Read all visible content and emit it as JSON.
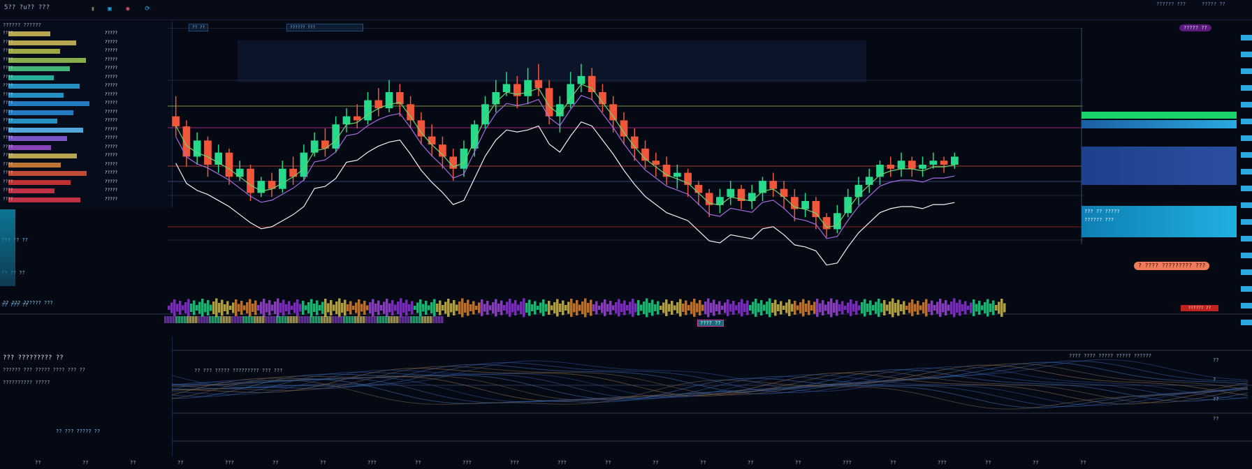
{
  "topbar": {
    "title": "5?? ?u?? ???",
    "icons": [
      {
        "name": "settings-icon",
        "glyph": "▮",
        "color": "#8a7a55"
      },
      {
        "name": "layout-icon",
        "glyph": "▣",
        "color": "#2aa9e0"
      },
      {
        "name": "alert-icon",
        "glyph": "◉",
        "color": "#e0556b"
      },
      {
        "name": "refresh-icon",
        "glyph": "⟳",
        "color": "#2aa9e0"
      }
    ],
    "right_labels": [
      "?????? ???",
      "????? ??"
    ]
  },
  "sidebar": {
    "header": "?????? ??????",
    "rows": [
      {
        "label": "????",
        "price": "?????",
        "color": "#d6c35a"
      },
      {
        "label": "????",
        "price": "?????",
        "color": "#d6c35a"
      },
      {
        "label": "????",
        "price": "?????",
        "color": "#b9c64d"
      },
      {
        "label": "????",
        "price": "?????",
        "color": "#9fcc55"
      },
      {
        "label": "????",
        "price": "?????",
        "color": "#4fd38a"
      },
      {
        "label": "????",
        "price": "?????",
        "color": "#2ecbb3"
      },
      {
        "label": "????",
        "price": "?????",
        "color": "#2aa9e0"
      },
      {
        "label": "????",
        "price": "?????",
        "color": "#2aa9e0"
      },
      {
        "label": "????",
        "price": "?????",
        "color": "#2a8fe0"
      },
      {
        "label": "????",
        "price": "?????",
        "color": "#2a8fe0"
      },
      {
        "label": "????",
        "price": "?????",
        "color": "#2aa9e0"
      },
      {
        "label": "????",
        "price": "?????",
        "color": "#5ec4ff"
      },
      {
        "label": "????",
        "price": "?????",
        "color": "#8f63e6"
      },
      {
        "label": "????",
        "price": "?????",
        "color": "#a04fd6"
      },
      {
        "label": "????",
        "price": "?????",
        "color": "#d6c35a"
      },
      {
        "label": "????",
        "price": "?????",
        "color": "#e08a3a"
      },
      {
        "label": "????",
        "price": "?????",
        "color": "#e0573a"
      },
      {
        "label": "????",
        "price": "?????",
        "color": "#e03a3a"
      },
      {
        "label": "????",
        "price": "?????",
        "color": "#e03a4f"
      },
      {
        "label": "????",
        "price": "?????",
        "color": "#e03a4f"
      }
    ],
    "side_labels": [
      "??? ?? ??",
      "?? ?? ??",
      "?? ??? ??"
    ]
  },
  "tabs": [
    "?? ??",
    "?????? ???"
  ],
  "chart_data": {
    "type": "candlestick",
    "colors": {
      "up": "#27d98a",
      "down": "#f0563a",
      "ma_fast": "#6fd36f",
      "ma_slow": "#a56be0",
      "price_line": "#f2f2f2"
    },
    "candles": [
      [
        60,
        55,
        70,
        50
      ],
      [
        55,
        40,
        58,
        35
      ],
      [
        40,
        48,
        52,
        36
      ],
      [
        48,
        36,
        50,
        30
      ],
      [
        36,
        42,
        46,
        32
      ],
      [
        42,
        30,
        44,
        26
      ],
      [
        30,
        34,
        38,
        28
      ],
      [
        34,
        22,
        36,
        18
      ],
      [
        22,
        28,
        30,
        20
      ],
      [
        28,
        24,
        32,
        20
      ],
      [
        24,
        34,
        38,
        22
      ],
      [
        34,
        30,
        40,
        26
      ],
      [
        30,
        42,
        46,
        28
      ],
      [
        42,
        48,
        52,
        40
      ],
      [
        48,
        44,
        54,
        40
      ],
      [
        44,
        56,
        60,
        42
      ],
      [
        56,
        60,
        64,
        52
      ],
      [
        60,
        58,
        66,
        54
      ],
      [
        58,
        68,
        72,
        56
      ],
      [
        68,
        64,
        74,
        60
      ],
      [
        64,
        72,
        78,
        62
      ],
      [
        72,
        66,
        76,
        60
      ],
      [
        66,
        58,
        70,
        54
      ],
      [
        58,
        50,
        62,
        46
      ],
      [
        50,
        46,
        56,
        40
      ],
      [
        46,
        40,
        50,
        34
      ],
      [
        40,
        34,
        44,
        28
      ],
      [
        34,
        44,
        48,
        30
      ],
      [
        44,
        56,
        58,
        40
      ],
      [
        56,
        66,
        70,
        54
      ],
      [
        66,
        72,
        78,
        62
      ],
      [
        72,
        76,
        82,
        70
      ],
      [
        76,
        70,
        80,
        64
      ],
      [
        70,
        78,
        84,
        66
      ],
      [
        78,
        74,
        86,
        70
      ],
      [
        74,
        60,
        78,
        56
      ],
      [
        60,
        66,
        70,
        52
      ],
      [
        66,
        76,
        82,
        64
      ],
      [
        76,
        80,
        86,
        72
      ],
      [
        80,
        72,
        84,
        68
      ],
      [
        72,
        66,
        76,
        62
      ],
      [
        66,
        58,
        70,
        52
      ],
      [
        58,
        50,
        62,
        46
      ],
      [
        50,
        44,
        54,
        38
      ],
      [
        44,
        38,
        48,
        34
      ],
      [
        38,
        36,
        42,
        30
      ],
      [
        36,
        30,
        40,
        26
      ],
      [
        30,
        32,
        36,
        24
      ],
      [
        32,
        26,
        34,
        20
      ],
      [
        26,
        22,
        28,
        16
      ],
      [
        22,
        16,
        24,
        10
      ],
      [
        16,
        20,
        24,
        12
      ],
      [
        20,
        24,
        28,
        16
      ],
      [
        24,
        18,
        26,
        14
      ],
      [
        18,
        22,
        26,
        14
      ],
      [
        22,
        28,
        30,
        18
      ],
      [
        28,
        24,
        32,
        20
      ],
      [
        24,
        20,
        28,
        14
      ],
      [
        20,
        14,
        24,
        8
      ],
      [
        14,
        18,
        22,
        10
      ],
      [
        18,
        10,
        20,
        4
      ],
      [
        10,
        4,
        12,
        0
      ],
      [
        4,
        12,
        16,
        2
      ],
      [
        12,
        20,
        24,
        10
      ],
      [
        20,
        26,
        30,
        16
      ],
      [
        26,
        30,
        34,
        22
      ],
      [
        30,
        36,
        38,
        26
      ],
      [
        36,
        34,
        40,
        30
      ],
      [
        34,
        38,
        42,
        30
      ],
      [
        38,
        34,
        40,
        30
      ],
      [
        34,
        36,
        40,
        30
      ],
      [
        36,
        38,
        42,
        34
      ],
      [
        38,
        36,
        40,
        32
      ],
      [
        36,
        40,
        42,
        34
      ]
    ],
    "y_range": [
      0,
      90
    ]
  },
  "right_panel": {
    "top_tag": "????? ??",
    "pill": "? ???? ????????? ???",
    "red_tag": "?????? ??",
    "blue_rows": [
      "??? ?? ?????",
      "?????? ???"
    ]
  },
  "volume": {
    "label": "?? ??? ?????? ???",
    "chip": "???? ??"
  },
  "indicator": {
    "left_title": "??? ????????? ??",
    "left_sub": "?????? ??? ????? ???? ??? ??",
    "left_rows": [
      "?????????? ?????",
      "?? ??? ????? ??"
    ],
    "center_label": "?? ??? ????? ????????? ??? ???",
    "right_label": "???? ???? ????? ????? ??????",
    "axis": [
      "??",
      "?",
      "??",
      "??"
    ]
  },
  "xaxis": [
    "??",
    "??",
    "??",
    "??",
    "???",
    "??",
    "??",
    "???",
    "??",
    "???",
    "???",
    "???",
    "??",
    "??",
    "??",
    "??",
    "??",
    "???",
    "??",
    "???",
    "??",
    "??",
    "??"
  ]
}
